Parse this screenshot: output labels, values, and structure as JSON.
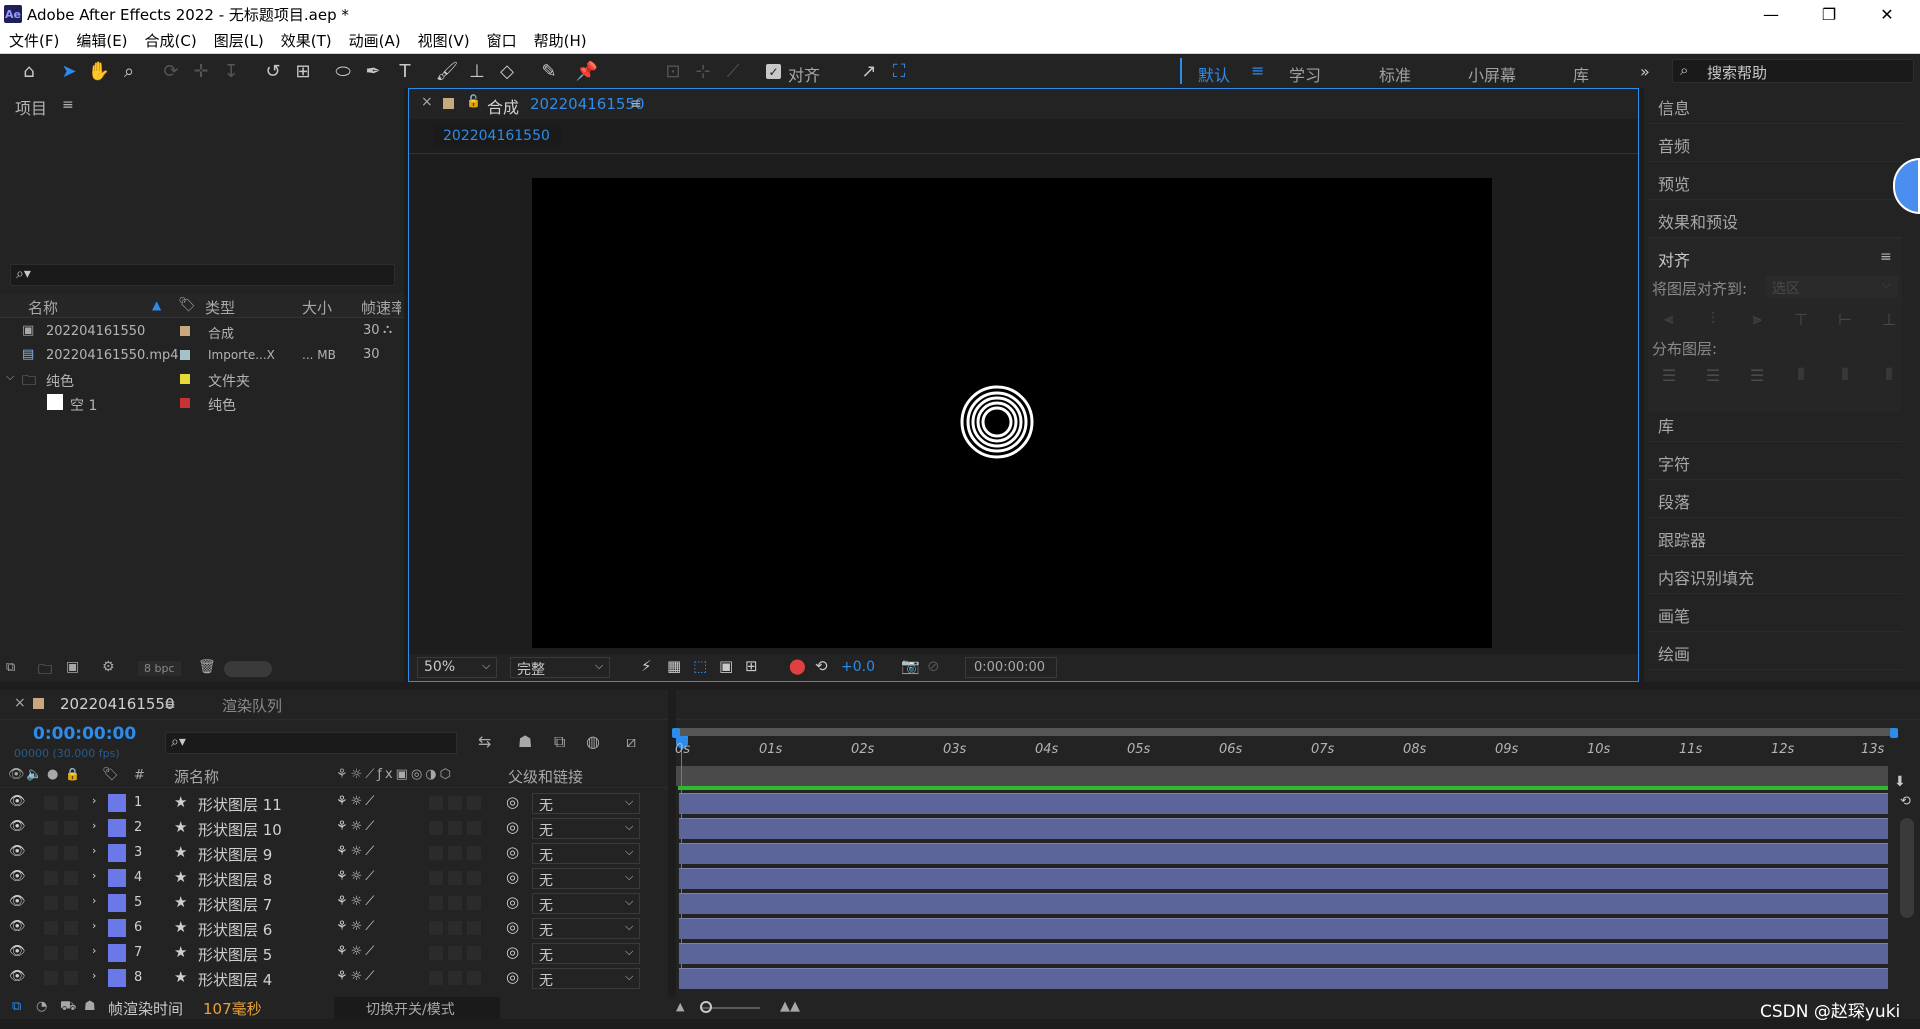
{
  "window": {
    "title": "Adobe After Effects 2022 - 无标题项目.aep *",
    "app_badge": "Ae",
    "minimize": "—",
    "restore": "❐",
    "close": "✕"
  },
  "menu": [
    "文件(F)",
    "编辑(E)",
    "合成(C)",
    "图层(L)",
    "效果(T)",
    "动画(A)",
    "视图(V)",
    "窗口",
    "帮助(H)"
  ],
  "toolbar": {
    "snap_label": "对齐",
    "workspaces": [
      "默认",
      "学习",
      "标准",
      "小屏幕",
      "库"
    ],
    "active_workspace": "默认",
    "more": "»",
    "help_placeholder": "搜索帮助"
  },
  "project": {
    "title": "项目",
    "columns": [
      "名称",
      "类型",
      "大小",
      "帧速率"
    ],
    "rows": [
      {
        "name": "202204161550",
        "type": "合成",
        "size": "",
        "fps": "30",
        "color": "#c8a97e"
      },
      {
        "name": "202204161550.mp4",
        "type": "Importe...X",
        "size": "... MB",
        "fps": "30",
        "color": "#a4c3c8"
      },
      {
        "name": "纯色",
        "type": "文件夹",
        "size": "",
        "fps": "",
        "color": "#e8d93a"
      },
      {
        "name": "空 1",
        "type": "纯色",
        "size": "",
        "fps": "",
        "color": "#c83232"
      }
    ],
    "bpc": "8 bpc"
  },
  "composition": {
    "close": "×",
    "tab_prefix": "合成",
    "tab_name": "202204161550",
    "sub_tab": "202204161550",
    "zoom": "50%",
    "quality": "完整",
    "exposure": "+0.0",
    "timecode": "0:00:00:00"
  },
  "right_panels": {
    "info": "信息",
    "audio": "音频",
    "preview": "预览",
    "effects": "效果和预设",
    "align": "对齐",
    "align_to_label": "将图层对齐到:",
    "align_to_value": "选区",
    "distribute": "分布图层:",
    "library": "库",
    "character": "字符",
    "paragraph": "段落",
    "tracker": "跟踪器",
    "content_fill": "内容识别填充",
    "brush": "画笔",
    "paint": "绘画"
  },
  "timeline": {
    "close": "×",
    "comp_tab": "202204161550",
    "render_tab": "渲染队列",
    "timecode": "0:00:00:00",
    "frame_info": "00000 (30.000 fps)",
    "col_num": "#",
    "col_source": "源名称",
    "col_parent": "父级和链接",
    "ruler": [
      "0s",
      "01s",
      "02s",
      "03s",
      "04s",
      "05s",
      "06s",
      "07s",
      "08s",
      "09s",
      "10s",
      "11s",
      "12s",
      "13s"
    ],
    "layers": [
      {
        "num": "1",
        "name": "形状图层 11",
        "parent": "无"
      },
      {
        "num": "2",
        "name": "形状图层 10",
        "parent": "无"
      },
      {
        "num": "3",
        "name": "形状图层 9",
        "parent": "无"
      },
      {
        "num": "4",
        "name": "形状图层 8",
        "parent": "无"
      },
      {
        "num": "5",
        "name": "形状图层 7",
        "parent": "无"
      },
      {
        "num": "6",
        "name": "形状图层 6",
        "parent": "无"
      },
      {
        "num": "7",
        "name": "形状图层 5",
        "parent": "无"
      },
      {
        "num": "8",
        "name": "形状图层 4",
        "parent": "无"
      }
    ],
    "layer_color": "#6b78e8",
    "render_time_label": "帧渲染时间",
    "render_time_value": "107毫秒",
    "toggle_label": "切换开关/模式"
  },
  "watermark": "CSDN @赵琛yuki"
}
